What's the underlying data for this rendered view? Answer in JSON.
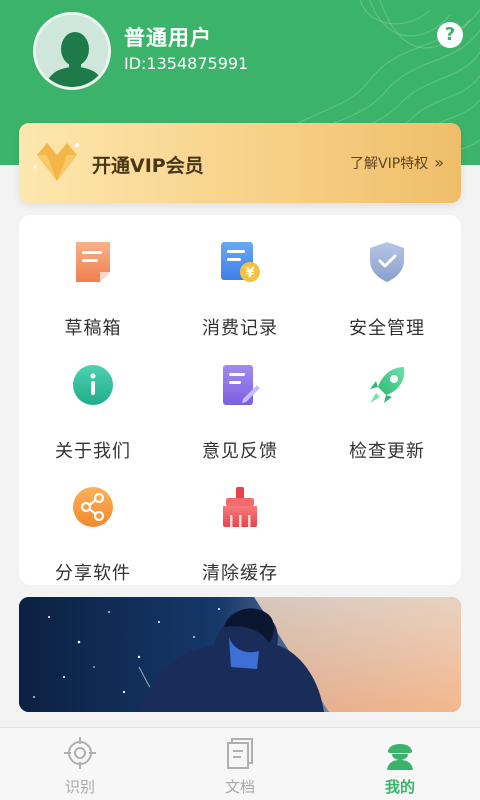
{
  "profile": {
    "name": "普通用户",
    "id_text": "ID:1354875991",
    "help_symbol": "?"
  },
  "vip": {
    "title": "开通VIP会员",
    "link": "了解VIP特权",
    "link_arrow": "»"
  },
  "menu": {
    "items": [
      {
        "label": "草稿箱",
        "icon": "drafts-icon"
      },
      {
        "label": "消费记录",
        "icon": "consumption-record-icon"
      },
      {
        "label": "安全管理",
        "icon": "shield-icon"
      },
      {
        "label": "关于我们",
        "icon": "info-icon"
      },
      {
        "label": "意见反馈",
        "icon": "feedback-icon"
      },
      {
        "label": "检查更新",
        "icon": "rocket-icon"
      },
      {
        "label": "分享软件",
        "icon": "share-icon"
      },
      {
        "label": "清除缓存",
        "icon": "broom-icon"
      }
    ]
  },
  "tabs": [
    {
      "label": "识别",
      "icon": "scan-target-icon",
      "active": false
    },
    {
      "label": "文档",
      "icon": "document-icon",
      "active": false
    },
    {
      "label": "我的",
      "icon": "profile-icon",
      "active": true
    }
  ],
  "colors": {
    "brand_green": "#3cb36a",
    "vip_gold": "#f6cf85",
    "tab_inactive": "#a9a9a9"
  }
}
